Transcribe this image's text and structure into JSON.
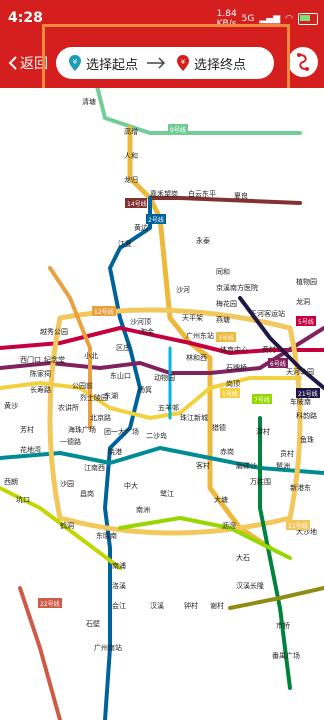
{
  "status": {
    "time": "4:28",
    "speed": "1.84",
    "speed_unit": "KB/s",
    "net": "5G",
    "battery": "5"
  },
  "header": {
    "back_label": "返回",
    "from_placeholder": "选择起点",
    "to_placeholder": "选择终点"
  },
  "map": {
    "stations": [
      "清塘",
      "高增",
      "人和",
      "龙归",
      "嘉禾望岗",
      "白云东平",
      "夏良",
      "黄边",
      "永泰",
      "江夏",
      "同和",
      "京溪南方医院",
      "梅花园",
      "燕塘",
      "天河客运站",
      "植物园",
      "龙洞",
      "广州东站",
      "林和西",
      "体育中心",
      "石牌桥",
      "岗顶",
      "天河公园",
      "车陂南",
      "珠江新城",
      "猎德",
      "潭村",
      "员村",
      "科韵路",
      "客村",
      "赤岗",
      "磨碟沙",
      "万胜围",
      "琶洲",
      "新港东",
      "大塘",
      "沥滘",
      "大石",
      "汉溪长隆",
      "市桥",
      "番禺广场",
      "南洲",
      "沙园",
      "昌岗",
      "江南西",
      "晓港",
      "中大",
      "鹭江",
      "西朗",
      "坑口",
      "花地湾",
      "芳村",
      "黄沙",
      "长寿路",
      "陈家祠",
      "西门口",
      "公园前",
      "农讲所",
      "海珠广场",
      "北京路",
      "一德路",
      "团一大广场",
      "二沙岛",
      "五羊邨",
      "杨箕",
      "东山口",
      "区庄",
      "淘金",
      "小北",
      "越秀公园",
      "纪念堂",
      "烈士陵园",
      "东湖",
      "动物园",
      "天平架",
      "沙河",
      "沙河顶",
      "黄村",
      "鱼珠",
      "大沙地",
      "鹤洞",
      "东晓南",
      "洛溪",
      "南浦",
      "会江",
      "石壁",
      "广州南站",
      "汉溪",
      "钟村",
      "谢村"
    ],
    "line_badges": [
      "9号线",
      "14号线",
      "2号线",
      "3号线",
      "6号线",
      "21号线",
      "5号线",
      "12号线",
      "11号线",
      "8号线",
      "7号线",
      "22号线",
      "13号线",
      "1号线"
    ],
    "colors": {
      "line1": "#f3d03e",
      "line2": "#00629b",
      "line3": "#ecb93c",
      "line4": "#00843d",
      "line5": "#c5003e",
      "line6": "#80225f",
      "line7": "#97d700",
      "line8": "#008c95",
      "line9": "#71cc98",
      "line11": "#f2c75c",
      "line12": "#e9a03f",
      "line13": "#8e8c13",
      "line14": "#81312f",
      "line21": "#201747",
      "line22": "#cd5b45",
      "apm": "#00b5e2",
      "guangfo": "#c4d600"
    }
  }
}
